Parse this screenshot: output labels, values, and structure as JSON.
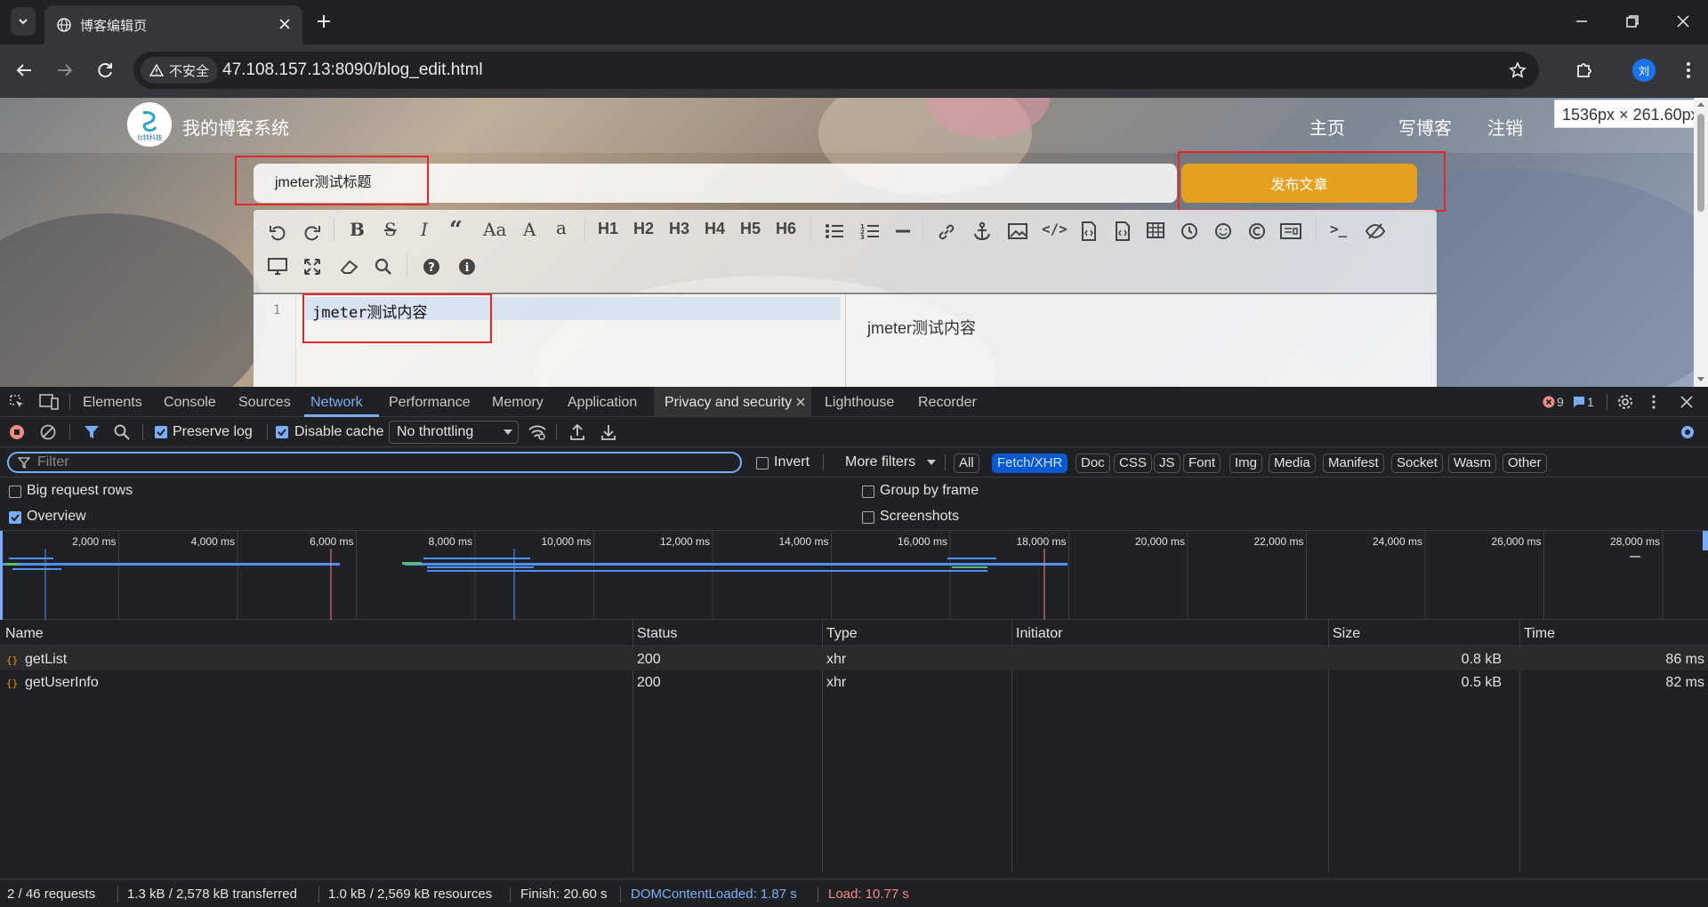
{
  "browser": {
    "tab_title": "博客编辑页",
    "security_label": "不安全",
    "url": "47.108.157.13:8090/blog_edit.html",
    "profile_initial": "刘",
    "accent": "#1a73e8"
  },
  "blog": {
    "site_name": "我的博客系统",
    "logo_text": "比特科技",
    "nav": [
      "主页",
      "写博客",
      "注销"
    ],
    "size_tooltip": "1536px × 261.60px",
    "title_value": "jmeter测试标题",
    "publish_label": "发布文章",
    "publish_color": "#e6a020",
    "highlight_color": "#e02a2a",
    "editor": {
      "headings": [
        "H1",
        "H2",
        "H3",
        "H4",
        "H5",
        "H6"
      ],
      "font_label": "Aa",
      "line_number": "1",
      "content": "jmeter测试内容",
      "preview": "jmeter测试内容"
    }
  },
  "devtools": {
    "tabs": [
      "Elements",
      "Console",
      "Sources",
      "Network",
      "Performance",
      "Memory",
      "Application",
      "Privacy and security",
      "Lighthouse",
      "Recorder"
    ],
    "active_tab": "Network",
    "errors": "9",
    "messages": "1",
    "toolbar": {
      "preserve_log": "Preserve log",
      "disable_cache": "Disable cache",
      "throttling": "No throttling"
    },
    "filter": {
      "placeholder": "Filter",
      "invert": "Invert",
      "more_filters": "More filters",
      "types": [
        "All",
        "Fetch/XHR",
        "Doc",
        "CSS",
        "JS",
        "Font",
        "Img",
        "Media",
        "Manifest",
        "Socket",
        "Wasm",
        "Other"
      ],
      "active_type": "Fetch/XHR"
    },
    "options": {
      "big_request_rows": "Big request rows",
      "group_by_frame": "Group by frame",
      "overview": "Overview",
      "screenshots": "Screenshots"
    },
    "overview_ticks": [
      "2,000 ms",
      "4,000 ms",
      "6,000 ms",
      "8,000 ms",
      "10,000 ms",
      "12,000 ms",
      "14,000 ms",
      "16,000 ms",
      "18,000 ms",
      "20,000 ms",
      "22,000 ms",
      "24,000 ms",
      "26,000 ms",
      "28,000 ms"
    ],
    "columns": [
      "Name",
      "Status",
      "Type",
      "Initiator",
      "Size",
      "Time"
    ],
    "rows": [
      {
        "name": "getList",
        "status": "200",
        "type": "xhr",
        "initiator": "",
        "size": "0.8 kB",
        "time": "86 ms"
      },
      {
        "name": "getUserInfo",
        "status": "200",
        "type": "xhr",
        "initiator": "",
        "size": "0.5 kB",
        "time": "82 ms"
      }
    ],
    "status_bar": {
      "requests": "2 / 46 requests",
      "transferred": "1.3 kB / 2,578 kB transferred",
      "resources": "1.0 kB / 2,569 kB resources",
      "finish": "Finish: 20.60 s",
      "dom_loaded": "DOMContentLoaded: 1.87 s",
      "load": "Load: 10.77 s",
      "dom_color": "#7cacf8",
      "load_color": "#f28b82"
    }
  }
}
